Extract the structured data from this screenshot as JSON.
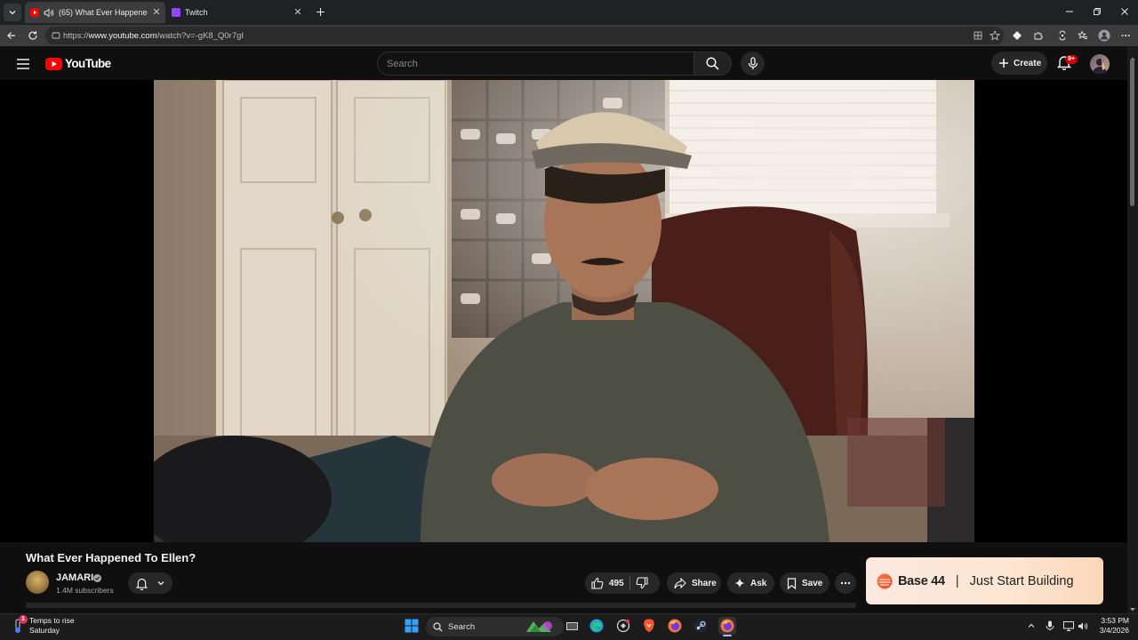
{
  "browser": {
    "tabs": [
      {
        "title": "(65) What Ever Happened To Ellen?",
        "active": true
      },
      {
        "title": "Twitch",
        "active": false
      }
    ],
    "url_scheme": "https://",
    "url_host": "www.youtube.com",
    "url_path": "/watch?v=-gK8_Q0r7gI"
  },
  "youtube": {
    "logo_text": "YouTube",
    "search_placeholder": "Search",
    "create_label": "Create",
    "notification_count": "9+"
  },
  "video": {
    "title": "What Ever Happened To Ellen?",
    "channel": "JAMARI",
    "subscribers": "1.4M subscribers",
    "likes": "495",
    "share_label": "Share",
    "ask_label": "Ask",
    "save_label": "Save"
  },
  "ad": {
    "brand": "Base 44",
    "separator": "|",
    "tagline": "Just Start Building"
  },
  "taskbar": {
    "weather_line1": "Temps to rise",
    "weather_line2": "Saturday",
    "weather_badge": "1",
    "search_label": "Search",
    "time": "3:53 PM",
    "date": "3/4/2026"
  },
  "colors": {
    "yt_red": "#ff0000",
    "background": "#0f0f0f",
    "badge_red": "#cc0000"
  }
}
